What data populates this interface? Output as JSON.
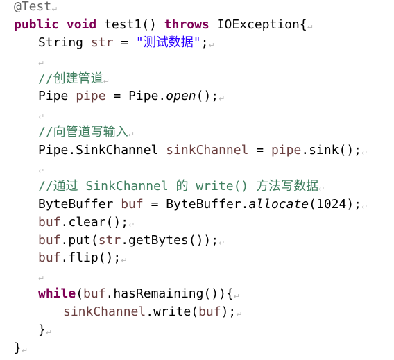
{
  "code": {
    "line1": {
      "annotation": "@Test"
    },
    "line2": {
      "kw_public": "public",
      "kw_void": "void",
      "method_decl": " test1() ",
      "kw_throws": "throws",
      "exception": " IOException{"
    },
    "line3": {
      "type": "String",
      "var": "str",
      "eq": " = ",
      "str_lit": "\"测试数据\"",
      "end": ";"
    },
    "line5": {
      "comment": "//创建管道"
    },
    "line6": {
      "type": "Pipe",
      "var": "pipe",
      "eq": " = Pipe.",
      "static_method": "open",
      "end": "();"
    },
    "line8": {
      "comment": "//向管道写输入"
    },
    "line9": {
      "type": "Pipe.SinkChannel",
      "var": "sinkChannel",
      "eq": " = ",
      "var_ref": "pipe",
      "end": ".sink();"
    },
    "line11": {
      "comment": "//通过 SinkChannel 的 write() 方法写数据"
    },
    "line12": {
      "type": "ByteBuffer",
      "var": "buf",
      "eq": " = ByteBuffer.",
      "static_method": "allocate",
      "end": "(1024);"
    },
    "line13": {
      "var": "buf",
      "end": ".clear();"
    },
    "line14": {
      "var": "buf",
      "mid": ".put(",
      "var2": "str",
      "end": ".getBytes());"
    },
    "line15": {
      "var": "buf",
      "end": ".flip();"
    },
    "line17": {
      "kw_while": "while",
      "open": "(",
      "var": "buf",
      "end": ".hasRemaining()){"
    },
    "line18": {
      "var": "sinkChannel",
      "mid": ".write(",
      "var2": "buf",
      "end": ");"
    },
    "line19": {
      "brace": "}"
    },
    "line20": {
      "brace": "}"
    }
  },
  "paragraph_mark": "↵"
}
